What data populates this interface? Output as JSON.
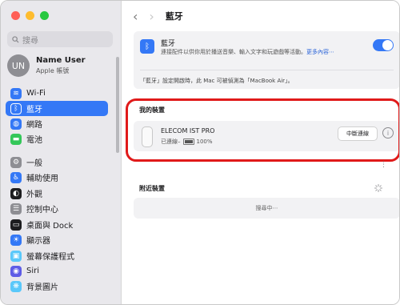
{
  "sidebar": {
    "search_placeholder": "搜尋",
    "user": {
      "initials": "UN",
      "name": "Name User",
      "subtitle": "Apple 帳號"
    },
    "items": [
      {
        "label": "Wi-Fi",
        "icon": "wifi-icon",
        "color": "#3478f6",
        "active": false
      },
      {
        "label": "藍牙",
        "icon": "bluetooth-icon",
        "color": "#3478f6",
        "active": true
      },
      {
        "label": "網路",
        "icon": "globe-icon",
        "color": "#3478f6",
        "active": false
      },
      {
        "label": "電池",
        "icon": "battery-icon",
        "color": "#34c759",
        "active": false
      },
      {
        "label": "一般",
        "icon": "gear-icon",
        "color": "#8e8e93",
        "active": false
      },
      {
        "label": "輔助使用",
        "icon": "accessibility-icon",
        "color": "#3478f6",
        "active": false
      },
      {
        "label": "外觀",
        "icon": "appearance-icon",
        "color": "#1d1d1f",
        "active": false
      },
      {
        "label": "控制中心",
        "icon": "control-center-icon",
        "color": "#8e8e93",
        "active": false
      },
      {
        "label": "桌面與 Dock",
        "icon": "dock-icon",
        "color": "#1d1d1f",
        "active": false
      },
      {
        "label": "顯示器",
        "icon": "display-icon",
        "color": "#3478f6",
        "active": false
      },
      {
        "label": "螢幕保護程式",
        "icon": "screensaver-icon",
        "color": "#5ac8fa",
        "active": false
      },
      {
        "label": "Siri",
        "icon": "siri-icon",
        "color": "#5e5ce6",
        "active": false
      },
      {
        "label": "背景圖片",
        "icon": "wallpaper-icon",
        "color": "#5ac8fa",
        "active": false
      }
    ]
  },
  "header": {
    "title": "藍牙",
    "back": "‹",
    "forward": "›"
  },
  "bluetooth_card": {
    "title": "藍牙",
    "description": "連接配件以供你用於播送音樂、輸入文字和玩遊戲等活動。",
    "more": "更多內容⋯",
    "enabled": true,
    "note": "「藍牙」設定開啟時，此 Mac 可被偵測為「MacBook Air」。"
  },
  "my_devices": {
    "title": "我的裝置",
    "devices": [
      {
        "name": "ELECOM IST PRO",
        "status": "已連線–",
        "battery": "100%",
        "action": "中斷連線"
      }
    ]
  },
  "nearby": {
    "title": "附近裝置",
    "status": "搜尋中⋯"
  }
}
